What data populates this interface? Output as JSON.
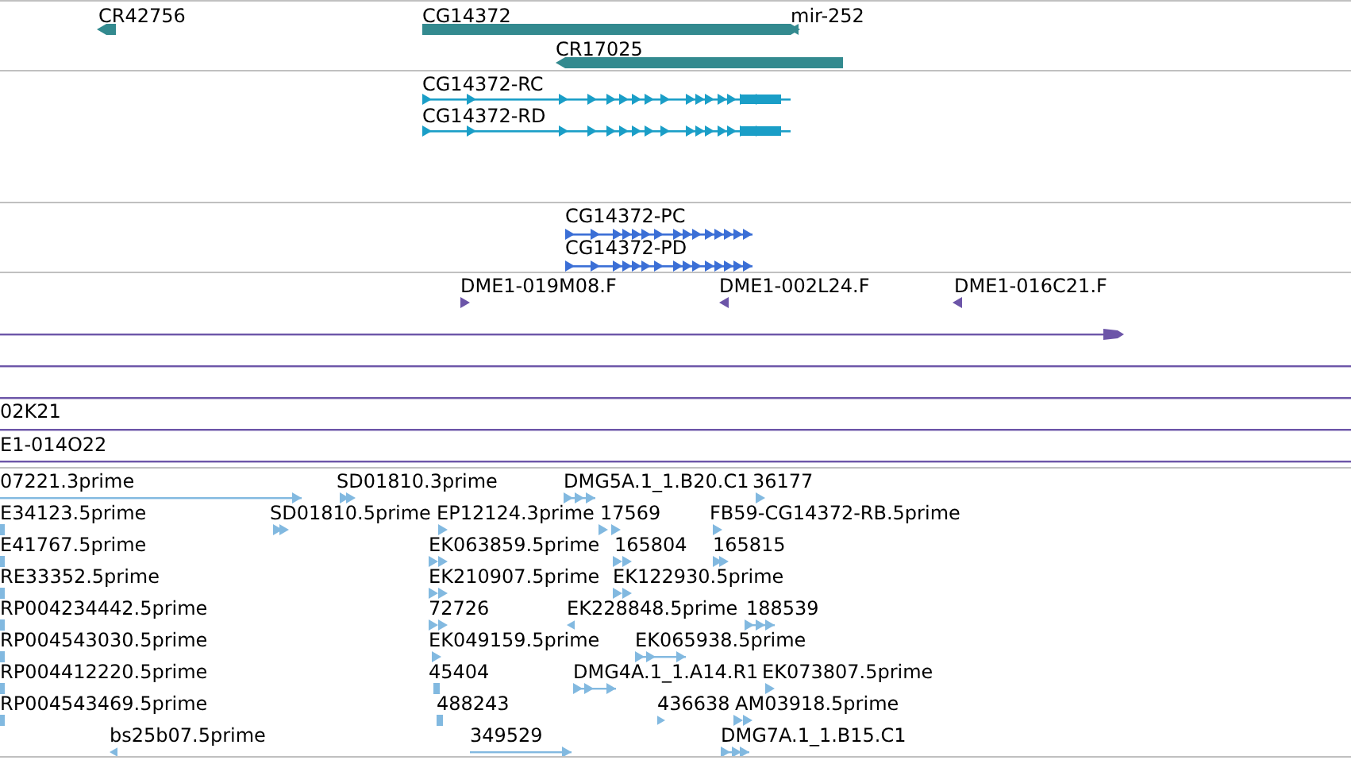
{
  "tracks": [
    {
      "kind": "gene",
      "features": [
        {
          "label": "CR42756",
          "forward": false
        },
        {
          "label": "CG14372",
          "forward": true
        },
        {
          "label": "mir-252",
          "forward": false
        },
        {
          "label": "CR17025",
          "forward": false
        }
      ]
    },
    {
      "kind": "transcript",
      "features": [
        {
          "label": "CG14372-RC",
          "forward": true
        },
        {
          "label": "CG14372-RD",
          "forward": true
        }
      ]
    },
    {
      "kind": "protein",
      "features": [
        {
          "label": "CG14372-PC",
          "forward": true
        },
        {
          "label": "CG14372-PD",
          "forward": true
        }
      ]
    },
    {
      "kind": "clone",
      "features": [
        {
          "label": "DME1-019M08.F",
          "forward": true
        },
        {
          "label": "DME1-002L24.F",
          "forward": false
        },
        {
          "label": "DME1-016C21.F",
          "forward": false
        },
        {
          "label": "02K21"
        },
        {
          "label": "E1-014O22"
        }
      ]
    },
    {
      "kind": "est",
      "features": [
        {
          "label": "07221.3prime",
          "forward": true
        },
        {
          "label": "SD01810.3prime",
          "forward": true
        },
        {
          "label": "DMG5A.1_1.B20.C1",
          "forward": true
        },
        {
          "label": "36177",
          "forward": true
        },
        {
          "label": "E34123.5prime"
        },
        {
          "label": "SD01810.5prime",
          "forward": true
        },
        {
          "label": "EP12124.3prime",
          "forward": true
        },
        {
          "label": "17569",
          "forward": true
        },
        {
          "label": "FB59-CG14372-RB.5prime",
          "forward": true
        },
        {
          "label": "E41767.5prime"
        },
        {
          "label": "EK063859.5prime",
          "forward": true
        },
        {
          "label": "165804",
          "forward": true
        },
        {
          "label": "165815",
          "forward": true
        },
        {
          "label": "RE33352.5prime"
        },
        {
          "label": "EK210907.5prime",
          "forward": true
        },
        {
          "label": "EK122930.5prime",
          "forward": true
        },
        {
          "label": "RP004234442.5prime"
        },
        {
          "label": "72726",
          "forward": true
        },
        {
          "label": "EK228848.5prime",
          "forward": false
        },
        {
          "label": "188539",
          "forward": true
        },
        {
          "label": "RP004543030.5prime"
        },
        {
          "label": "EK049159.5prime",
          "forward": true
        },
        {
          "label": "EK065938.5prime",
          "forward": true
        },
        {
          "label": "RP004412220.5prime"
        },
        {
          "label": "45404"
        },
        {
          "label": "DMG4A.1_1.A14.R1",
          "forward": true
        },
        {
          "label": "EK073807.5prime",
          "forward": true
        },
        {
          "label": "RP004543469.5prime"
        },
        {
          "label": "488243"
        },
        {
          "label": "436638",
          "forward": true
        },
        {
          "label": "AM03918.5prime",
          "forward": true
        },
        {
          "label": "bs25b07.5prime",
          "forward": false
        },
        {
          "label": "349529",
          "forward": true
        },
        {
          "label": "DMG7A.1_1.B15.C1",
          "forward": true
        }
      ]
    }
  ]
}
